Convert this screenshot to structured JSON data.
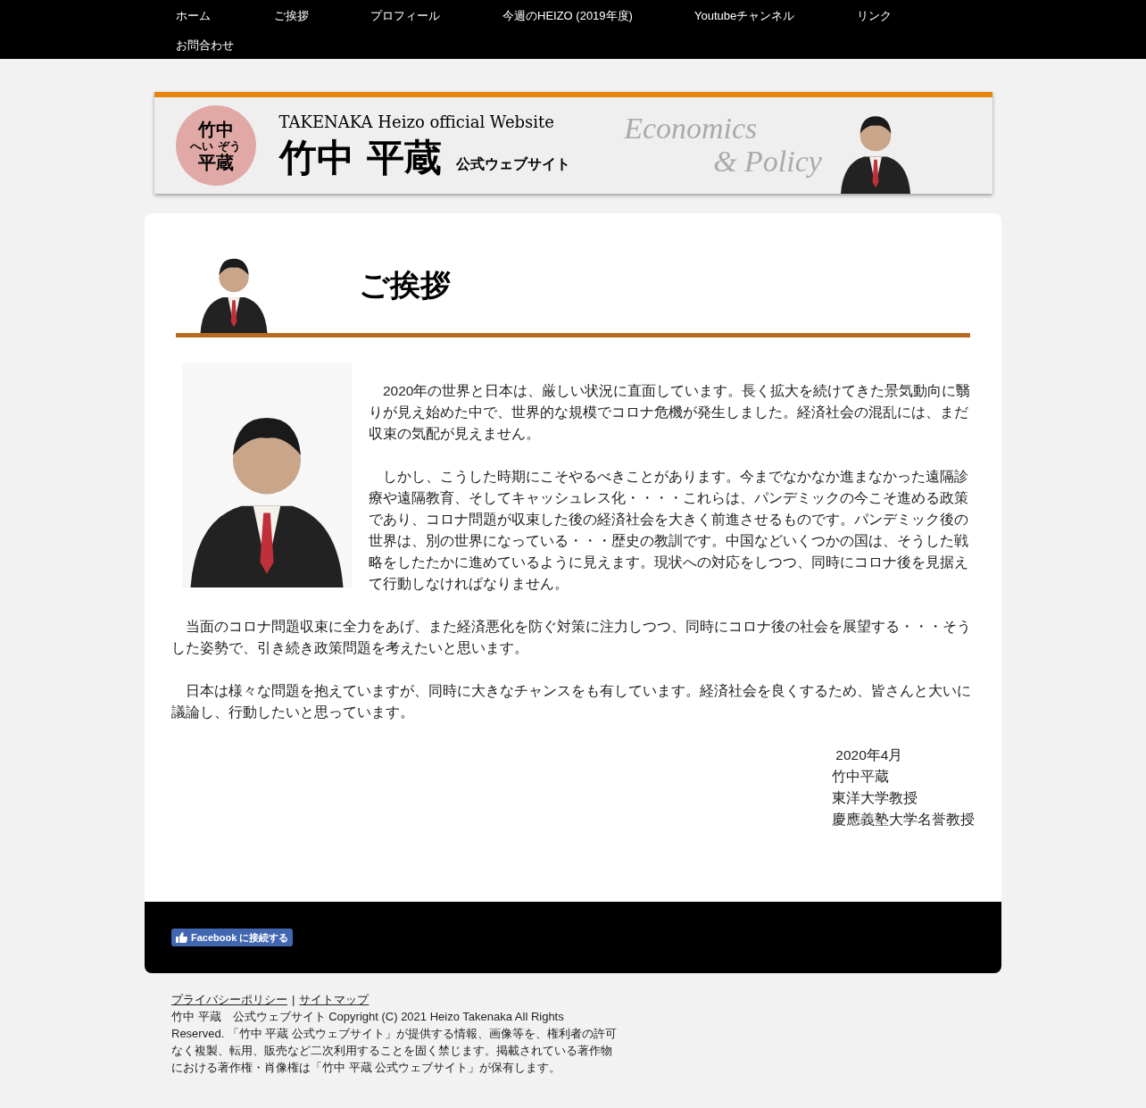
{
  "nav": [
    "ホーム",
    "ご挨拶",
    "プロフィール",
    "今週のHEIZO (2019年度)",
    "Youtubeチャンネル",
    "リンク",
    "お問合わせ"
  ],
  "banner": {
    "logo_top": "竹中",
    "logo_reading": "へい ぞう",
    "logo_bottom": "平蔵",
    "subtitle": "TAKENAKA Heizo official Website",
    "name": "竹中 平蔵",
    "tagline": "公式ウェブサイト",
    "word_1": "Economics",
    "word_2": "& Policy"
  },
  "heading": "ご挨拶",
  "intro_paragraphs": [
    "　2020年の世界と日本は、厳しい状況に直面しています。長く拡大を続けてきた景気動向に翳りが見え始めた中で、世界的な規模でコロナ危機が発生しました。経済社会の混乱には、まだ収束の気配が見えません。",
    "　しかし、こうした時期にこそやるべきことがあります。今までなかなか進まなかった遠隔診療や遠隔教育、そしてキャッシュレス化・・・・これらは、パンデミックの今こそ進める政策であり、コロナ問題が収束した後の経済社会を大きく前進させるものです。パンデミック後の世界は、別の世界になっている・・・歴史の教訓です。中国などいくつかの国は、そうした戦略をしたたかに進めているように見えます。現状への対応をしつつ、同時にコロナ後を見据えて行動しなければなりません。"
  ],
  "paragraphs": [
    "　当面のコロナ問題収束に全力をあげ、また経済悪化を防ぐ対策に注力しつつ、同時にコロナ後の社会を展望する・・・そうした姿勢で、引き続き政策問題を考えたいと思います。",
    "　日本は様々な問題を抱えていますが、同時に大きなチャンスをも有しています。経済社会を良くするため、皆さんと大いに議論し、行動したいと思っています。"
  ],
  "signature": [
    " 2020年4月",
    "竹中平蔵",
    "東洋大学教授",
    "慶應義塾大学名誉教授"
  ],
  "facebook_button": "Facebook に接続する",
  "footer": {
    "links": [
      "プライバシーポリシー",
      "サイトマップ"
    ],
    "separator": "|",
    "copyright": "竹中 平蔵　公式ウェブサイト Copyright (C) 2021 Heizo Takenaka All Rights Reserved. 「竹中 平蔵 公式ウェブサイト」が提供する情報、画像等を、権利者の許可なく複製、転用、販売など二次利用することを固く禁じます。掲載されている著作物における著作権・肖像権は「竹中 平蔵 公式ウェブサイト」が保有します。"
  }
}
